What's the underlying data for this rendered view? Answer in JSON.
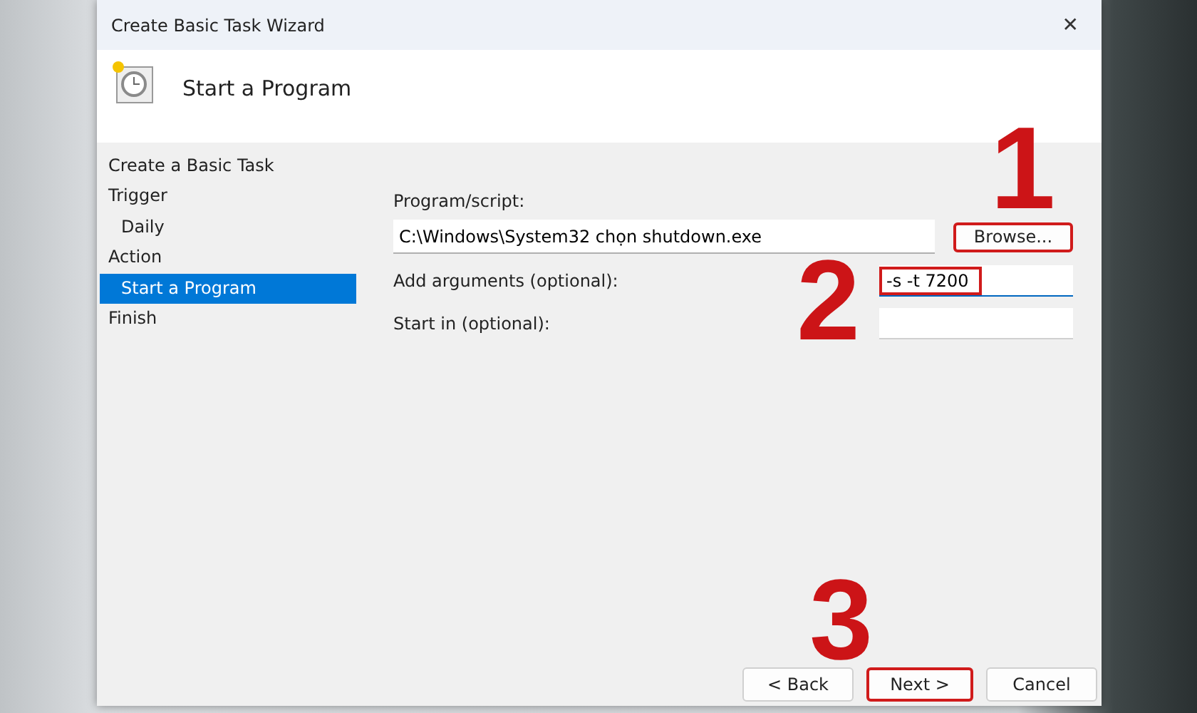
{
  "window": {
    "title": "Create Basic Task Wizard",
    "close": "✕"
  },
  "header": {
    "title": "Start a Program"
  },
  "steps": [
    {
      "label": "Create a Basic Task",
      "selected": false
    },
    {
      "label": "Trigger",
      "selected": false,
      "children": [
        {
          "label": "Daily",
          "selected": false
        }
      ]
    },
    {
      "label": "Action",
      "selected": false,
      "children": [
        {
          "label": "Start a Program",
          "selected": true
        }
      ]
    },
    {
      "label": "Finish",
      "selected": false
    }
  ],
  "program": {
    "label": "Program/script:",
    "value": "C:\\Windows\\System32 chọn shutdown.exe",
    "browse": {
      "label": "Browse...",
      "highlighted": true,
      "annotation": "1"
    }
  },
  "fields": [
    {
      "label": "Add arguments (optional):",
      "value": "-s -t 7200",
      "highlighted": true,
      "annotation": "2"
    },
    {
      "label": "Start in (optional):"
    }
  ],
  "buttons": [
    {
      "label": "< Back",
      "highlighted": false
    },
    {
      "label": "Next >",
      "highlighted": true,
      "annotation": "3"
    },
    {
      "label": "Cancel",
      "highlighted": false
    }
  ]
}
